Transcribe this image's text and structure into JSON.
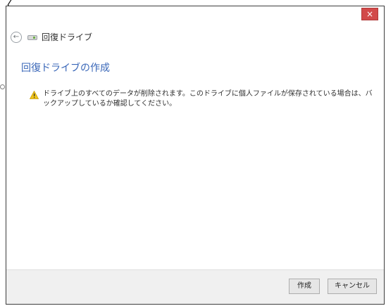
{
  "window": {
    "close_glyph": "×",
    "nav_title": "回復ドライブ"
  },
  "main": {
    "heading": "回復ドライブの作成",
    "warning_text": "ドライブ上のすべてのデータが削除されます。このドライブに個人ファイルが保存されている場合は、バックアップしているか確認してください。"
  },
  "footer": {
    "create_label": "作成",
    "cancel_label": "キャンセル"
  },
  "overlay": {
    "corner_glyph": "〈"
  },
  "colors": {
    "accent": "#3a67b8",
    "close": "#d24a4a",
    "warning": "#f0c419"
  },
  "icons": [
    "back-icon",
    "drive-icon",
    "warning-icon",
    "close-icon"
  ]
}
